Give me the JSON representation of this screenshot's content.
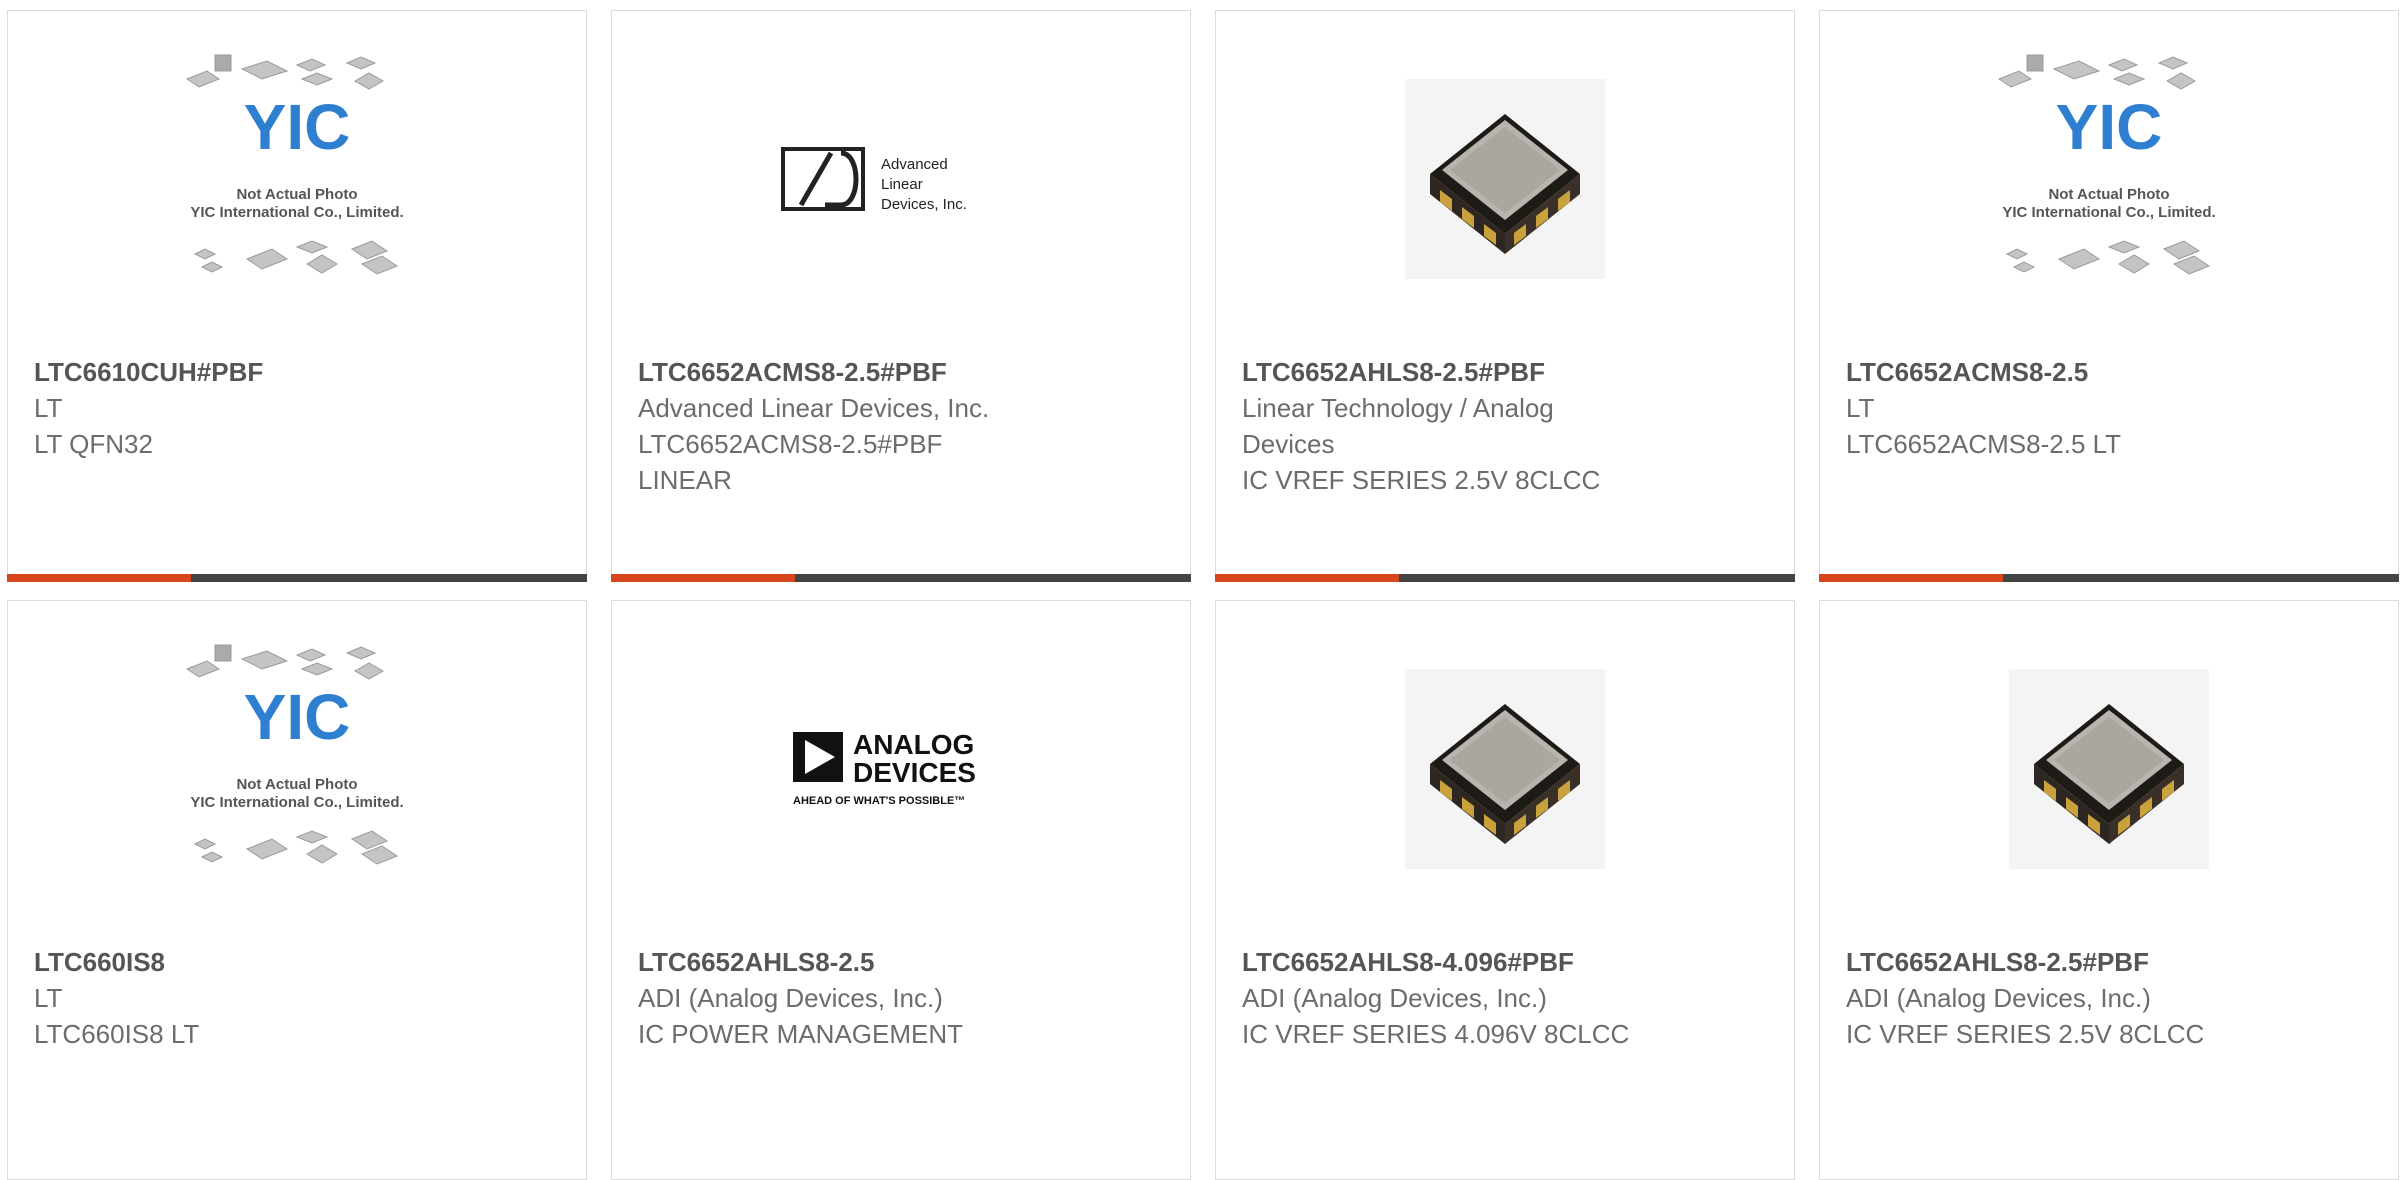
{
  "colors": {
    "accent": "#d7461d",
    "bar": "#444444",
    "border": "#dcdcdc",
    "brand_blue": "#2f7fd1"
  },
  "yic_logo": {
    "brand": "YIC",
    "caption_line1": "Not Actual Photo",
    "caption_line2": "YIC International Co., Limited."
  },
  "ald_logo": {
    "line1": "Advanced",
    "line2": "Linear",
    "line3": "Devices, Inc."
  },
  "adi_logo": {
    "line1": "ANALOG",
    "line2": "DEVICES",
    "tagline": "AHEAD OF WHAT'S POSSIBLE™"
  },
  "products": [
    {
      "image": "yic-placeholder",
      "part_number": "LTC6610CUH#PBF",
      "manufacturer": "LT",
      "description": [
        "LT QFN32"
      ]
    },
    {
      "image": "ald-logo",
      "part_number": "LTC6652ACMS8-2.5#PBF",
      "manufacturer": "Advanced Linear Devices, Inc.",
      "description": [
        "LTC6652ACMS8-2.5#PBF",
        "LINEAR"
      ]
    },
    {
      "image": "chip-photo",
      "part_number": "LTC6652AHLS8-2.5#PBF",
      "manufacturer": "Linear Technology / Analog",
      "manufacturer_cont": "Devices",
      "description": [
        "IC VREF SERIES 2.5V 8CLCC"
      ]
    },
    {
      "image": "yic-placeholder",
      "part_number": "LTC6652ACMS8-2.5",
      "manufacturer": "LT",
      "description": [
        "LTC6652ACMS8-2.5 LT"
      ]
    },
    {
      "image": "yic-placeholder",
      "part_number": "LTC660IS8",
      "manufacturer": "LT",
      "description": [
        "LTC660IS8 LT"
      ]
    },
    {
      "image": "adi-logo",
      "part_number": "LTC6652AHLS8-2.5",
      "manufacturer": "ADI (Analog Devices, Inc.)",
      "description": [
        "IC POWER MANAGEMENT"
      ]
    },
    {
      "image": "chip-photo",
      "part_number": "LTC6652AHLS8-4.096#PBF",
      "manufacturer": "ADI (Analog Devices, Inc.)",
      "description": [
        "IC VREF SERIES 4.096V 8CLCC"
      ]
    },
    {
      "image": "chip-photo",
      "part_number": "LTC6652AHLS8-2.5#PBF",
      "manufacturer": "ADI (Analog Devices, Inc.)",
      "description": [
        "IC VREF SERIES 2.5V 8CLCC"
      ]
    }
  ]
}
